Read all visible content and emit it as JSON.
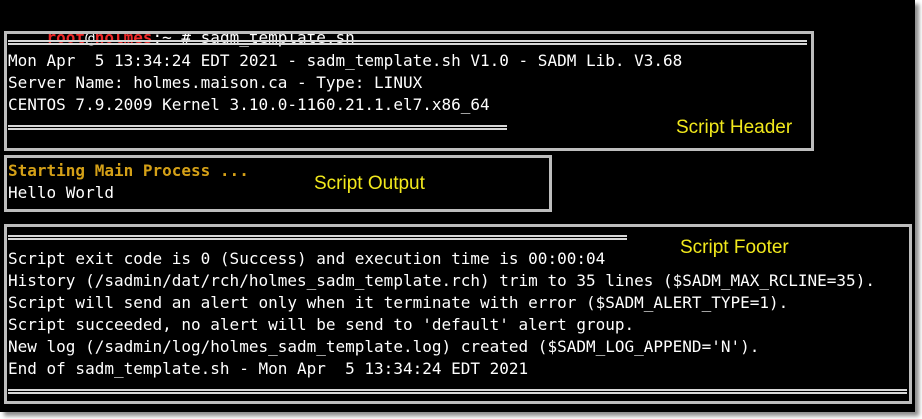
{
  "prompt": {
    "user": "root",
    "at": "@",
    "host": "holmes",
    "path": ":~ # ",
    "command": "sadm_template.sh"
  },
  "header": {
    "label": "Script Header",
    "lines": [
      "Mon Apr  5 13:34:24 EDT 2021 - sadm_template.sh V1.0 - SADM Lib. V3.68",
      "Server Name: holmes.maison.ca - Type: LINUX",
      "CENTOS 7.9.2009 Kernel 3.10.0-1160.21.1.el7.x86_64"
    ]
  },
  "output": {
    "label": "Script Output",
    "starting": "Starting Main Process ...",
    "hello": "Hello World"
  },
  "footer": {
    "label": "Script Footer",
    "lines": [
      "Script exit code is 0 (Success) and execution time is 00:00:04",
      "History (/sadmin/dat/rch/holmes_sadm_template.rch) trim to 35 lines ($SADM_MAX_RCLINE=35).",
      "Script will send an alert only when it terminate with error ($SADM_ALERT_TYPE=1).",
      "Script succeeded, no alert will be send to 'default' alert group.",
      "New log (/sadmin/log/holmes_sadm_template.log) created ($SADM_LOG_APPEND='N').",
      "End of sadm_template.sh - Mon Apr  5 13:34:24 EDT 2021"
    ]
  },
  "colors": {
    "terminal_bg": "#000000",
    "prompt_user": "#ef2929",
    "highlight_text": "#d4a017",
    "annotation_label": "#f2e91c",
    "annotation_border": "#bdbdbd"
  }
}
